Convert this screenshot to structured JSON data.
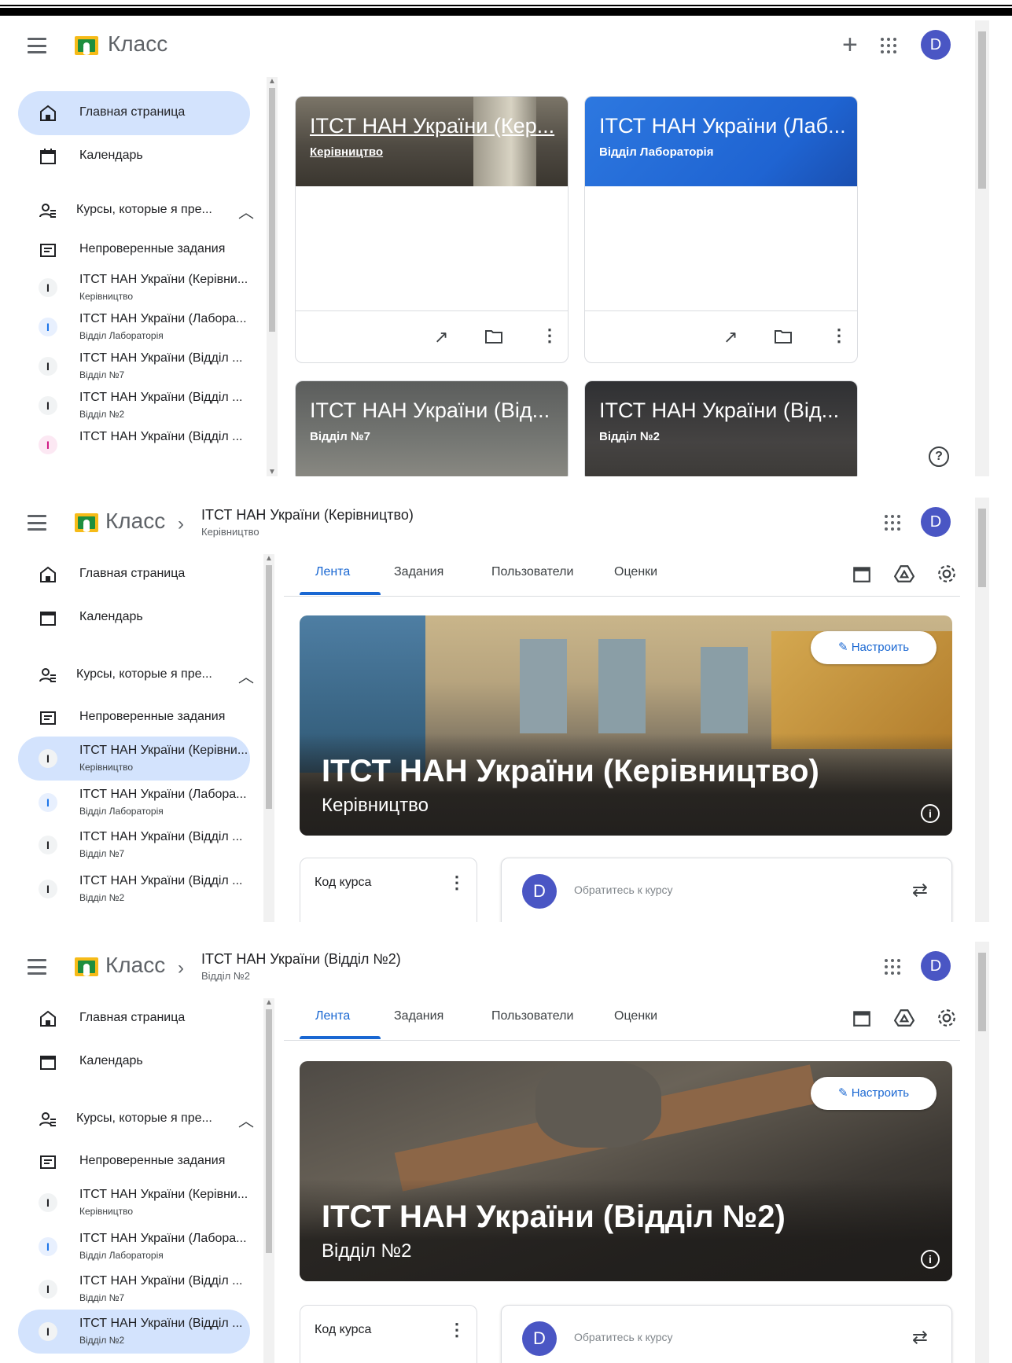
{
  "app": {
    "name": "Класс",
    "avatar_letter": "D"
  },
  "sidebar": {
    "home": "Главная страница",
    "calendar": "Календарь",
    "teaching": "Курсы, которые я пре...",
    "todo": "Непроверенные задания",
    "courses": [
      {
        "initial": "I",
        "name": "ІТСТ НАН України (Керівни...",
        "section": "Керівництво"
      },
      {
        "initial": "I",
        "name": "ІТСТ НАН України (Лабора...",
        "section": "Відділ Лабораторія"
      },
      {
        "initial": "I",
        "name": "ІТСТ НАН України (Відділ ...",
        "section": "Відділ №7"
      },
      {
        "initial": "I",
        "name": "ІТСТ НАН України (Відділ ...",
        "section": "Відділ №2"
      },
      {
        "initial": "I",
        "name": "ІТСТ НАН України (Відділ ...",
        "section": ""
      }
    ]
  },
  "home_cards": [
    {
      "title": "ІТСТ НАН України (Кер...",
      "section": "Керівництво"
    },
    {
      "title": "ІТСТ НАН України (Лаб...",
      "section": "Відділ Лабораторія"
    },
    {
      "title": "ІТСТ НАН України (Від...",
      "section": "Відділ №7"
    },
    {
      "title": "ІТСТ НАН України (Від...",
      "section": "Відділ №2"
    }
  ],
  "tabs": {
    "stream": "Лента",
    "classwork": "Задания",
    "people": "Пользователи",
    "grades": "Оценки"
  },
  "stream": {
    "customize": "Настроить",
    "code_label": "Код курса",
    "announce_placeholder": "Обратитесь к курсу"
  },
  "course1": {
    "title": "ІТСТ НАН України (Керівництво)",
    "section": "Керівництво"
  },
  "course2": {
    "title": "ІТСТ НАН України (Відділ №2)",
    "section": "Відділ №2"
  },
  "colors": {
    "accent": "#1967d2",
    "active_nav": "#d3e3fd",
    "avatar": "#4a56c4"
  }
}
